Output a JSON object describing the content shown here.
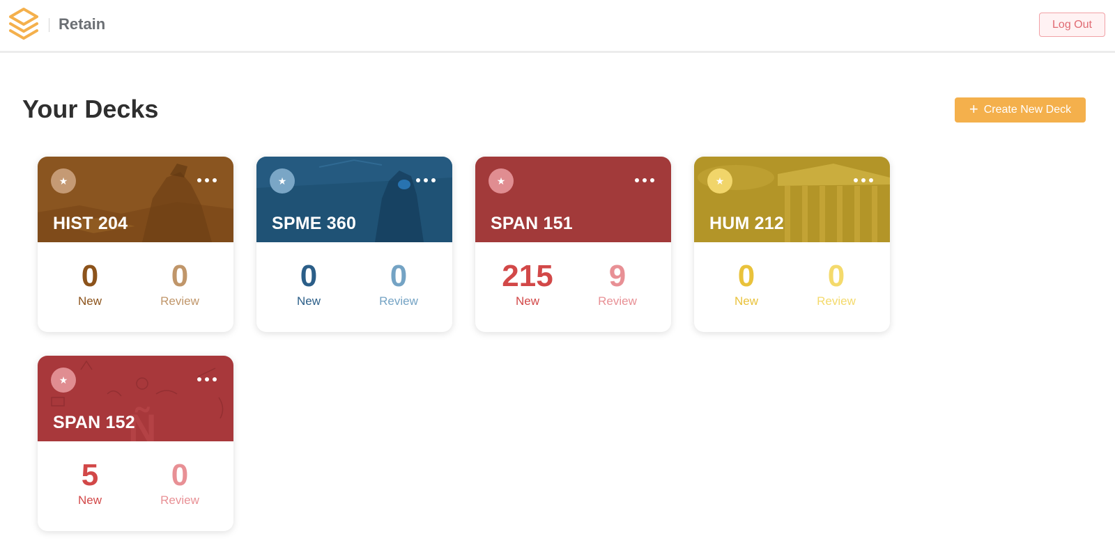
{
  "app": {
    "name": "Retain"
  },
  "header": {
    "logout_label": "Log Out"
  },
  "main": {
    "title": "Your Decks",
    "create_label": "Create New Deck"
  },
  "colors": {
    "accent": "#f4b04c",
    "logout_text": "#e06a72"
  },
  "decks": [
    {
      "name": "HIST 204",
      "new_count": "0",
      "review_count": "0",
      "new_label": "New",
      "review_label": "Review",
      "theme": "brown",
      "banner_color": "#8a5520",
      "new_color": "#8c531b",
      "review_color": "#c0966a",
      "star_bg": "#c59a74"
    },
    {
      "name": "SPME 360",
      "new_count": "0",
      "review_count": "0",
      "new_label": "New",
      "review_label": "Review",
      "theme": "blue",
      "banner_color": "#1f5275",
      "new_color": "#2b5e88",
      "review_color": "#74a3c4",
      "star_bg": "#7aa6c6"
    },
    {
      "name": "SPAN 151",
      "new_count": "215",
      "review_count": "9",
      "new_label": "New",
      "review_label": "Review",
      "theme": "red",
      "banner_color": "#a23a3a",
      "new_color": "#d24848",
      "review_color": "#e89095",
      "star_bg": "#e08d91"
    },
    {
      "name": "HUM 212",
      "new_count": "0",
      "review_count": "0",
      "new_label": "New",
      "review_label": "Review",
      "theme": "yellow",
      "banner_color": "#b39528",
      "new_color": "#e9c23b",
      "review_color": "#f4da6c",
      "star_bg": "#f1d56a"
    },
    {
      "name": "SPAN 152",
      "new_count": "5",
      "review_count": "0",
      "new_label": "New",
      "review_label": "Review",
      "theme": "red",
      "banner_color": "#a8383b",
      "new_color": "#d24848",
      "review_color": "#e89095",
      "star_bg": "#e08d91"
    }
  ]
}
